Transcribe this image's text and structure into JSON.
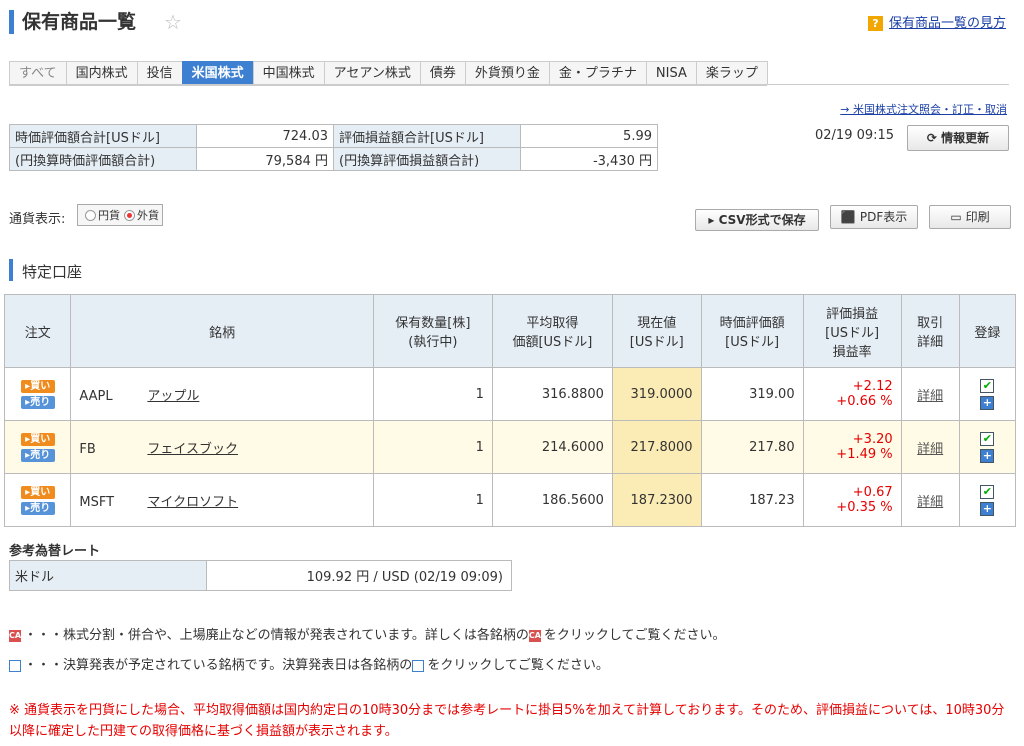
{
  "header": {
    "title": "保有商品一覧",
    "help_link": "保有商品一覧の見方"
  },
  "tabs": [
    "すべて",
    "国内株式",
    "投信",
    "米国株式",
    "中国株式",
    "アセアン株式",
    "債券",
    "外貨預り金",
    "金・プラチナ",
    "NISA",
    "楽ラップ"
  ],
  "active_tab": "米国株式",
  "order_link": "→ 米国株式注文照会・訂正・取消",
  "summary": {
    "market_value_label": "時価評価額合計[USドル]",
    "market_value": "724.03",
    "pl_label": "評価損益額合計[USドル]",
    "pl": "5.99",
    "jpy_value_label": "(円換算時価評価額合計)",
    "jpy_value": "79,584 円",
    "jpy_pl_label": "(円換算評価損益額合計)",
    "jpy_pl": "-3,430 円"
  },
  "timestamp": "02/19 09:15",
  "refresh_button": "情報更新",
  "currency": {
    "label": "通貨表示:",
    "jpy": "円貨",
    "foreign": "外貨",
    "selected": "外貨"
  },
  "buttons": {
    "csv": "▸ CSV形式で保存",
    "pdf": "PDF表示",
    "print": "印刷"
  },
  "section_title": "特定口座",
  "table": {
    "headers": {
      "order": "注文",
      "name": "銘柄",
      "qty": "保有数量[株]",
      "qty2": "(執行中)",
      "avg": "平均取得",
      "avg2": "価額[USドル]",
      "cur": "現在値",
      "cur2": "[USドル]",
      "mv": "時価評価額",
      "mv2": "[USドル]",
      "pl": "評価損益",
      "pl2": "[USドル]",
      "pl3": "損益率",
      "trade": "取引",
      "trade2": "詳細",
      "reg": "登録"
    },
    "buy_label": "▸買い",
    "sell_label": "▸売り",
    "detail_label": "詳細",
    "rows": [
      {
        "ticker": "AAPL",
        "name": "アップル",
        "qty": "1",
        "avg": "316.8800",
        "cur": "319.0000",
        "mv": "319.00",
        "pl": "+2.12",
        "rate": "+0.66 %"
      },
      {
        "ticker": "FB",
        "name": "フェイスブック",
        "qty": "1",
        "avg": "214.6000",
        "cur": "217.8000",
        "mv": "217.80",
        "pl": "+3.20",
        "rate": "+1.49 %"
      },
      {
        "ticker": "MSFT",
        "name": "マイクロソフト",
        "qty": "1",
        "avg": "186.5600",
        "cur": "187.2300",
        "mv": "187.23",
        "pl": "+0.67",
        "rate": "+0.35 %"
      }
    ]
  },
  "fx": {
    "title": "参考為替レート",
    "currency": "米ドル",
    "rate": "109.92 円 / USD (02/19 09:09)"
  },
  "notes": {
    "ca_icon": "CA",
    "ca_a": "・・・株式分割・併合や、上場廃止などの情報が発表されています。詳しくは各銘柄の",
    "ca_b": "をクリックしてご覧ください。",
    "earn_a": "・・・決算発表が予定されている銘柄です。決算発表日は各銘柄の",
    "earn_b": "をクリックしてご覧ください。"
  },
  "footnote": "※ 通貨表示を円貨にした場合、平均取得価額は国内約定日の10時30分までは参考レートに掛目5%を加えて計算しております。そのため、評価損益については、10時30分以降に確定した円建ての取得価格に基づく損益額が表示されます。"
}
